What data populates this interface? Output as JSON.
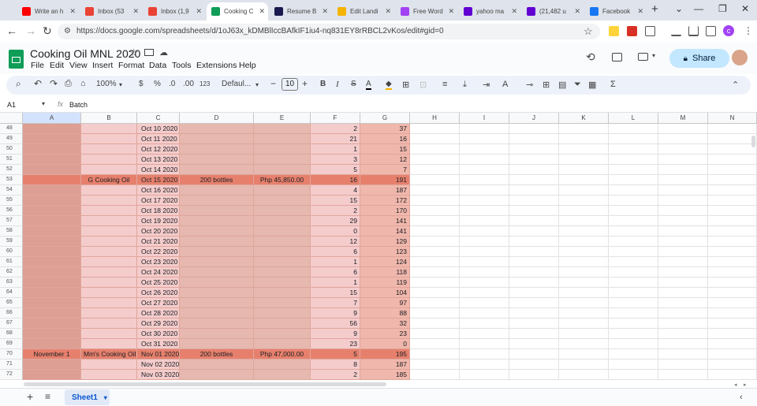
{
  "browser": {
    "tabs": [
      {
        "label": "Write an h",
        "icon": "youtube-icon",
        "color": "#ff0000"
      },
      {
        "label": "Inbox (53",
        "icon": "gmail-icon",
        "color": "#ea4335"
      },
      {
        "label": "Inbox (1,9",
        "icon": "gmail-icon",
        "color": "#ea4335"
      },
      {
        "label": "Cooking C",
        "icon": "sheets-icon",
        "color": "#0f9d58"
      },
      {
        "label": "Resume B",
        "icon": "resume-icon",
        "color": "#1a1a4e"
      },
      {
        "label": "Edit Landi",
        "icon": "landing-icon",
        "color": "#f4b400"
      },
      {
        "label": "Free Word",
        "icon": "word-icon",
        "color": "#a142f4"
      },
      {
        "label": "yahoo ma",
        "icon": "yahoo-icon",
        "color": "#6001d2"
      },
      {
        "label": "(21,482 u",
        "icon": "yahoo-mail-icon",
        "color": "#6001d2"
      },
      {
        "label": "Facebook",
        "icon": "facebook-icon",
        "color": "#1877f2"
      }
    ],
    "new_tab": "+",
    "url": "https://docs.google.com/spreadsheets/d/1oJ63x_kDMBlIccBAfkIF1iu4-nq831EY8rRBCL2vKos/edit#gid=0",
    "profile_initial": "c"
  },
  "doc": {
    "title": "Cooking Oil MNL 2020",
    "menu": [
      "File",
      "Edit",
      "View",
      "Insert",
      "Format",
      "Data",
      "Tools",
      "Extensions",
      "Help"
    ],
    "share_label": "Share"
  },
  "toolbar": {
    "zoom": "100%",
    "currency": "$",
    "percent": "%",
    "dec_less": ".0",
    "dec_more": ".00",
    "number_format": "123",
    "font": "Defaul...",
    "font_size": "10"
  },
  "formula": {
    "cell_ref": "A1",
    "fx": "fx",
    "value": "Batch"
  },
  "columns": [
    "A",
    "B",
    "C",
    "D",
    "E",
    "F",
    "G",
    "H",
    "I",
    "J",
    "K",
    "L",
    "M",
    "N"
  ],
  "rows": [
    {
      "n": "48",
      "b": "",
      "a": "",
      "c": "Oct 10 2020",
      "d": "",
      "e": "",
      "f": "2",
      "g": "37"
    },
    {
      "n": "49",
      "b": "",
      "a": "",
      "c": "Oct 11 2020",
      "d": "",
      "e": "",
      "f": "21",
      "g": "16"
    },
    {
      "n": "50",
      "b": "",
      "a": "",
      "c": "Oct 12 2020",
      "d": "",
      "e": "",
      "f": "1",
      "g": "15"
    },
    {
      "n": "51",
      "b": "",
      "a": "",
      "c": "Oct 13 2020",
      "d": "",
      "e": "",
      "f": "3",
      "g": "12"
    },
    {
      "n": "52",
      "b": "",
      "a": "",
      "c": "Oct 14 2020",
      "d": "",
      "e": "",
      "f": "5",
      "g": "7"
    },
    {
      "n": "53",
      "a": "",
      "b": "G Cooking Oil",
      "c": "Oct 15 2020",
      "d": "200 bottles",
      "e": "Php 45,850.00",
      "f": "16",
      "g": "191",
      "hl": true
    },
    {
      "n": "54",
      "a": "",
      "b": "",
      "c": "Oct 16 2020",
      "d": "",
      "e": "",
      "f": "4",
      "g": "187"
    },
    {
      "n": "55",
      "a": "",
      "b": "",
      "c": "Oct 17 2020",
      "d": "",
      "e": "",
      "f": "15",
      "g": "172"
    },
    {
      "n": "56",
      "a": "",
      "b": "",
      "c": "Oct 18 2020",
      "d": "",
      "e": "",
      "f": "2",
      "g": "170"
    },
    {
      "n": "57",
      "a": "",
      "b": "",
      "c": "Oct 19 2020",
      "d": "",
      "e": "",
      "f": "29",
      "g": "141"
    },
    {
      "n": "58",
      "a": "",
      "b": "",
      "c": "Oct 20 2020",
      "d": "",
      "e": "",
      "f": "0",
      "g": "141"
    },
    {
      "n": "59",
      "a": "",
      "b": "",
      "c": "Oct 21 2020",
      "d": "",
      "e": "",
      "f": "12",
      "g": "129"
    },
    {
      "n": "60",
      "a": "",
      "b": "",
      "c": "Oct 22 2020",
      "d": "",
      "e": "",
      "f": "6",
      "g": "123"
    },
    {
      "n": "61",
      "a": "",
      "b": "",
      "c": "Oct 23 2020",
      "d": "",
      "e": "",
      "f": "1",
      "g": "124"
    },
    {
      "n": "62",
      "a": "",
      "b": "",
      "c": "Oct 24 2020",
      "d": "",
      "e": "",
      "f": "6",
      "g": "118"
    },
    {
      "n": "63",
      "a": "",
      "b": "",
      "c": "Oct 25 2020",
      "d": "",
      "e": "",
      "f": "1",
      "g": "119"
    },
    {
      "n": "64",
      "a": "",
      "b": "",
      "c": "Oct 26 2020",
      "d": "",
      "e": "",
      "f": "15",
      "g": "104"
    },
    {
      "n": "65",
      "a": "",
      "b": "",
      "c": "Oct 27 2020",
      "d": "",
      "e": "",
      "f": "7",
      "g": "97"
    },
    {
      "n": "66",
      "a": "",
      "b": "",
      "c": "Oct 28 2020",
      "d": "",
      "e": "",
      "f": "9",
      "g": "88"
    },
    {
      "n": "67",
      "a": "",
      "b": "",
      "c": "Oct 29 2020",
      "d": "",
      "e": "",
      "f": "56",
      "g": "32"
    },
    {
      "n": "68",
      "a": "",
      "b": "",
      "c": "Oct 30 2020",
      "d": "",
      "e": "",
      "f": "9",
      "g": "23"
    },
    {
      "n": "69",
      "a": "",
      "b": "",
      "c": "Oct 31 2020",
      "d": "",
      "e": "",
      "f": "23",
      "g": "0"
    },
    {
      "n": "70",
      "a": "November 1",
      "b": "Mm's Cooking Oil",
      "c": "Nov 01 2020",
      "d": "200 bottles",
      "e": "Php 47,000.00",
      "f": "5",
      "g": "195",
      "hl": true
    },
    {
      "n": "71",
      "a": "",
      "b": "",
      "c": "Nov 02 2020",
      "d": "",
      "e": "",
      "f": "8",
      "g": "187"
    },
    {
      "n": "72",
      "a": "",
      "b": "",
      "c": "Nov 03 2020",
      "d": "",
      "e": "",
      "f": "2",
      "g": "185"
    }
  ],
  "sheets": [
    {
      "label": "Sheet1"
    }
  ],
  "colors": {
    "cell_pink": "#f4cccc",
    "cell_dark": "#e6b8af",
    "row_highlight": "#e6806d",
    "col_a": "#dd9e94",
    "accent": "#0b57d0"
  }
}
